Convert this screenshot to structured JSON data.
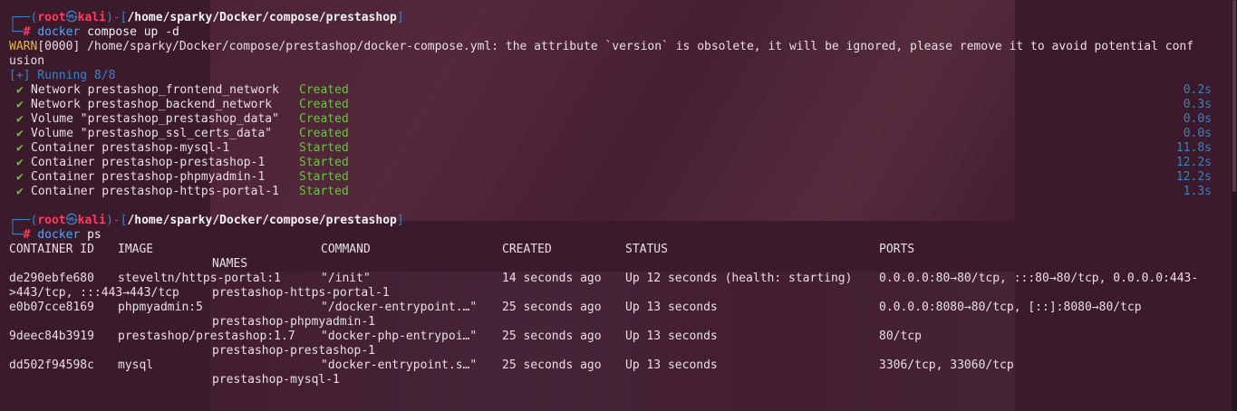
{
  "prompt": {
    "top": "┌──(",
    "user": "root",
    "skull": "㉿",
    "host": "kali",
    "mid": ")-[",
    "path": "/home/sparky/Docker/compose/prestashop",
    "end": "]",
    "bottom": "└─",
    "hash": "#"
  },
  "cmd1": {
    "bin": "docker",
    "args": " compose up -d"
  },
  "warn": {
    "tag": "WARN",
    "text1": "[0000] /home/sparky/Docker/compose/prestashop/docker-compose.yml: the attribute `version` is obsolete, it will be ignored, please remove it to avoid potential conf",
    "text2": "usion"
  },
  "running": "[+] Running 8/8",
  "check_glyph": "✔",
  "tasks": [
    {
      "name": "Network prestashop_frontend_network",
      "state": "Created",
      "time": "0.2s"
    },
    {
      "name": "Network prestashop_backend_network",
      "state": "Created",
      "time": "0.3s"
    },
    {
      "name": "Volume \"prestashop_prestashop_data\"",
      "state": "Created",
      "time": "0.0s"
    },
    {
      "name": "Volume \"prestashop_ssl_certs_data\"",
      "state": "Created",
      "time": "0.0s"
    },
    {
      "name": "Container prestashop-mysql-1",
      "state": "Started",
      "time": "11.8s"
    },
    {
      "name": "Container prestashop-prestashop-1",
      "state": "Started",
      "time": "12.2s"
    },
    {
      "name": "Container prestashop-phpmyadmin-1",
      "state": "Started",
      "time": "12.2s"
    },
    {
      "name": "Container prestashop-https-portal-1",
      "state": "Started",
      "time": "1.3s"
    }
  ],
  "cmd2": {
    "bin": "docker",
    "args": " ps"
  },
  "ps_headers": {
    "id": "CONTAINER ID",
    "image": "IMAGE",
    "command": "COMMAND",
    "created": "CREATED",
    "status": "STATUS",
    "ports": "PORTS",
    "names": "NAMES"
  },
  "ps_rows": [
    {
      "id": "de290ebfe680",
      "image": "steveltn/https-portal:1",
      "command": "\"/init\"",
      "created": "14 seconds ago",
      "status": "Up 12 seconds (health: starting)",
      "ports": "0.0.0.0:80→80/tcp, :::80→80/tcp, 0.0.0.0:443-",
      "ports_cont": ">443/tcp, :::443→443/tcp",
      "name": "prestashop-https-portal-1"
    },
    {
      "id": "e0b07cce8169",
      "image": "phpmyadmin:5",
      "command": "\"/docker-entrypoint.…\"",
      "created": "25 seconds ago",
      "status": "Up 13 seconds",
      "ports": "0.0.0.0:8080→80/tcp, [::]:8080→80/tcp",
      "name": "prestashop-phpmyadmin-1"
    },
    {
      "id": "9deec84b3919",
      "image": "prestashop/prestashop:1.7",
      "command": "\"docker-php-entrypoi…\"",
      "created": "25 seconds ago",
      "status": "Up 13 seconds",
      "ports": "80/tcp",
      "name": "prestashop-prestashop-1"
    },
    {
      "id": "dd502f94598c",
      "image": "mysql",
      "command": "\"docker-entrypoint.s…\"",
      "created": "25 seconds ago",
      "status": "Up 13 seconds",
      "ports": "3306/tcp, 33060/tcp",
      "name": "prestashop-mysql-1"
    }
  ]
}
